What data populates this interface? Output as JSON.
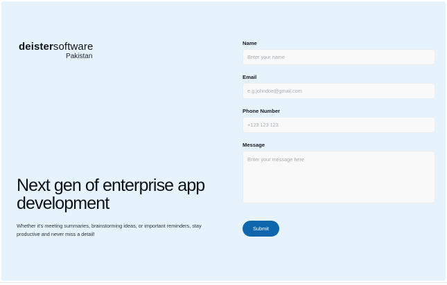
{
  "brand": {
    "name_bold": "deister",
    "name_light": "software",
    "region": "Pakistan"
  },
  "hero": {
    "headline": "Next gen of enterprise app development",
    "tagline": "Whether it's meeting summaries, brainstorming ideas, or important reminders, stay productive and never miss a detail!"
  },
  "form": {
    "name": {
      "label": "Name",
      "placeholder": "Enter your name"
    },
    "email": {
      "label": "Email",
      "placeholder": "e.g.johndoe@gmail.com"
    },
    "phone": {
      "label": "Phone Number",
      "placeholder": "+123 123 123"
    },
    "message": {
      "label": "Message",
      "placeholder": "Enter your message here"
    },
    "submit_label": "Submit"
  },
  "colors": {
    "background": "#e6f3fc",
    "accent": "#0e66ad",
    "field_background": "#f9f9f9"
  }
}
